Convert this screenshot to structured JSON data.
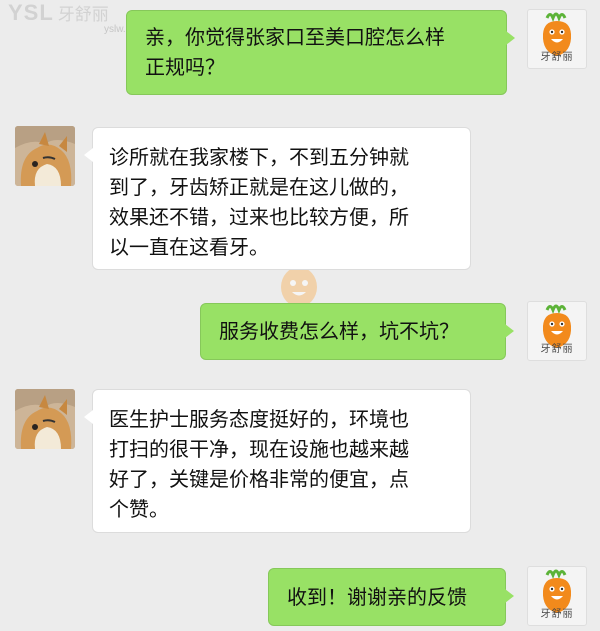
{
  "watermark": {
    "brand": "YSL",
    "name_cn": "牙舒丽",
    "url": "yslw.com"
  },
  "avatars": {
    "right_label": "牙舒丽",
    "left_icon": "dog-avatar",
    "right_icon": "carrot-mascot-icon"
  },
  "colors": {
    "sent_bubble": "#98e165",
    "received_bubble": "#ffffff",
    "background": "#ececec"
  },
  "messages": [
    {
      "side": "right",
      "text": "亲，你觉得张家口至美口腔怎么样\n正规吗？"
    },
    {
      "side": "left",
      "text": "诊所就在我家楼下，不到五分钟就\n到了，牙齿矫正就是在这儿做的，\n效果还不错，过来也比较方便，所\n以一直在这看牙。"
    },
    {
      "side": "right",
      "text": "服务收费怎么样，坑不坑？"
    },
    {
      "side": "left",
      "text": "医生护士服务态度挺好的，环境也\n打扫的很干净，现在设施也越来越\n好了，关键是价格非常的便宜，点\n个赞。"
    },
    {
      "side": "right",
      "text": "收到！谢谢亲的反馈"
    }
  ]
}
